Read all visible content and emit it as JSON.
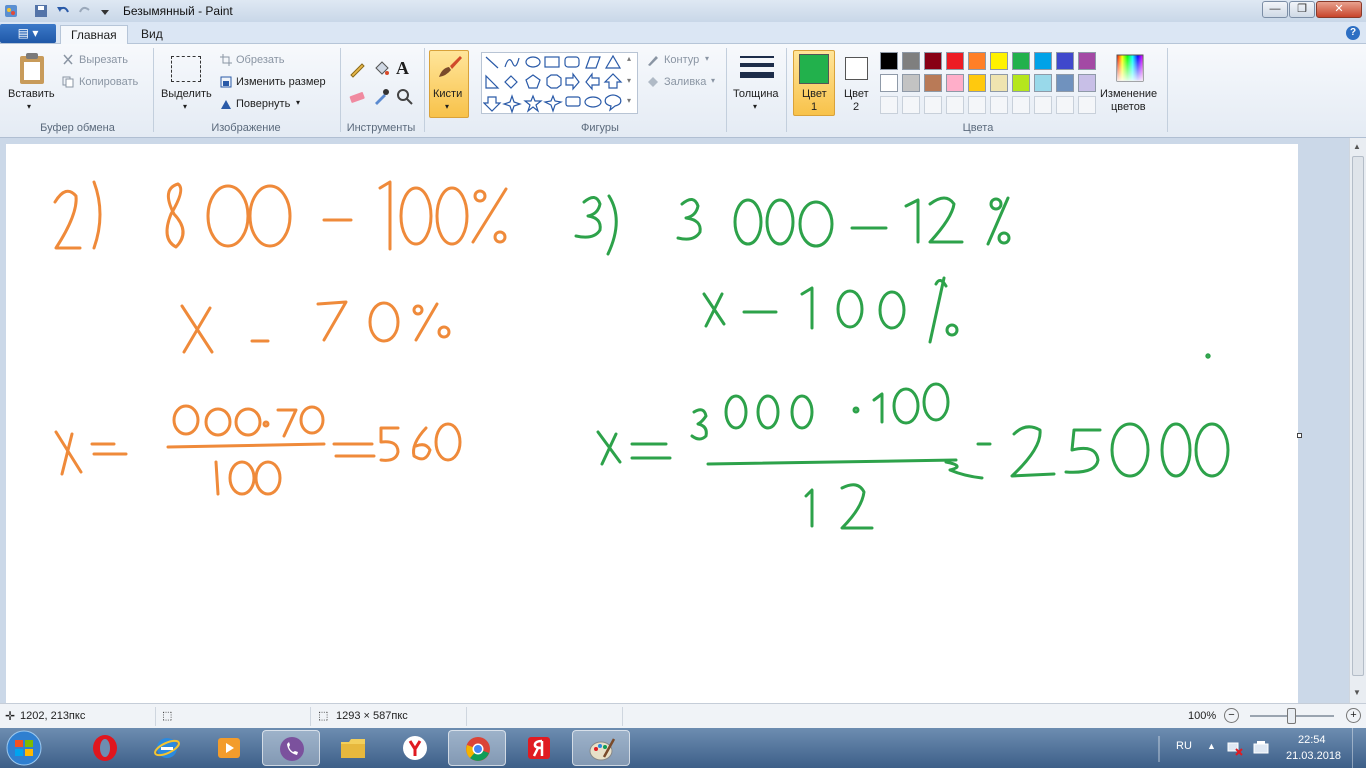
{
  "window": {
    "title": "Безымянный - Paint"
  },
  "tabs": {
    "home": "Главная",
    "view": "Вид"
  },
  "clipboard": {
    "paste": "Вставить",
    "cut": "Вырезать",
    "copy": "Копировать",
    "group": "Буфер обмена"
  },
  "image": {
    "select": "Выделить",
    "crop": "Обрезать",
    "resize": "Изменить размер",
    "rotate": "Повернуть",
    "group": "Изображение"
  },
  "tools": {
    "group": "Инструменты"
  },
  "brushes": {
    "label": "Кисти"
  },
  "shapes": {
    "outline": "Контур",
    "fill": "Заливка",
    "group": "Фигуры"
  },
  "size": {
    "label": "Толщина"
  },
  "colors": {
    "color1_a": "Цвет",
    "color1_b": "1",
    "color2_a": "Цвет",
    "color2_b": "2",
    "edit_a": "Изменение",
    "edit_b": "цветов",
    "group": "Цвета",
    "color1_value": "#22b14c",
    "color2_value": "#ffffff",
    "palette_row1": [
      "#000000",
      "#7f7f7f",
      "#880015",
      "#ed1c24",
      "#ff7f27",
      "#fff200",
      "#22b14c",
      "#00a2e8",
      "#3f48cc",
      "#a349a4"
    ],
    "palette_row2": [
      "#ffffff",
      "#c3c3c3",
      "#b97a57",
      "#ffaec9",
      "#ffc90e",
      "#efe4b0",
      "#b5e61d",
      "#99d9ea",
      "#7092be",
      "#c8bfe7"
    ]
  },
  "ink": {
    "orange": "#ef8a3a",
    "green": "#2da24a"
  },
  "status": {
    "cursor_pos": "1202, 213пкс",
    "canvas_size": "1293 × 587пкс",
    "zoom": "100%"
  },
  "taskbar": {
    "lang": "RU",
    "time": "22:54",
    "date": "21.03.2018"
  }
}
